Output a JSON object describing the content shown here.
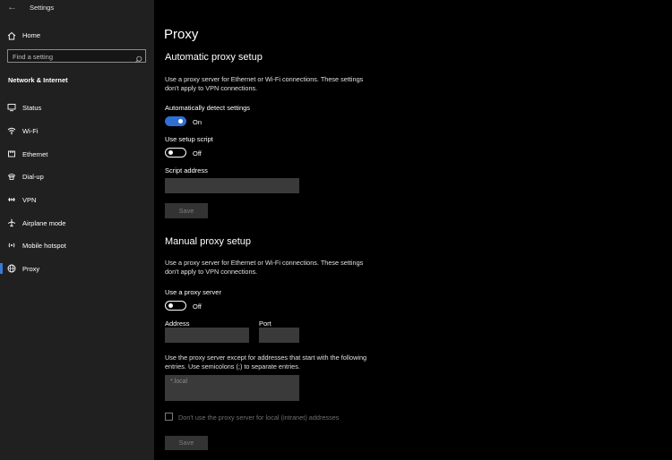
{
  "window": {
    "app_title": "Settings"
  },
  "sidebar": {
    "home_label": "Home",
    "search_placeholder": "Find a setting",
    "section_header": "Network & Internet",
    "items": [
      {
        "label": "Status",
        "icon": "status-icon"
      },
      {
        "label": "Wi-Fi",
        "icon": "wifi-icon"
      },
      {
        "label": "Ethernet",
        "icon": "ethernet-icon"
      },
      {
        "label": "Dial-up",
        "icon": "dial-up-icon"
      },
      {
        "label": "VPN",
        "icon": "vpn-icon"
      },
      {
        "label": "Airplane mode",
        "icon": "airplane-icon"
      },
      {
        "label": "Mobile hotspot",
        "icon": "hotspot-icon"
      },
      {
        "label": "Proxy",
        "icon": "globe-icon",
        "selected": true
      }
    ],
    "accent_color": "#3b78d8"
  },
  "main": {
    "page_title": "Proxy",
    "automatic": {
      "heading": "Automatic proxy setup",
      "description": "Use a proxy server for Ethernet or Wi-Fi connections. These settings don't apply to VPN connections.",
      "auto_detect_label": "Automatically detect settings",
      "auto_detect_state": "On",
      "setup_script_label": "Use setup script",
      "setup_script_state": "Off",
      "script_address_label": "Script address",
      "script_address_value": "",
      "save_label": "Save"
    },
    "manual": {
      "heading": "Manual proxy setup",
      "description": "Use a proxy server for Ethernet or Wi-Fi connections. These settings don't apply to VPN connections.",
      "use_proxy_label": "Use a proxy server",
      "use_proxy_state": "Off",
      "address_label": "Address",
      "address_value": "",
      "port_label": "Port",
      "port_value": "",
      "exceptions_description": "Use the proxy server except for addresses that start with the following entries. Use semicolons (;) to separate entries.",
      "exceptions_placeholder": "*.local",
      "local_bypass_label": "Don't use the proxy server for local (intranet) addresses",
      "local_bypass_checked": false,
      "save_label": "Save"
    },
    "toggle_on_color": "#2f6fd1"
  }
}
